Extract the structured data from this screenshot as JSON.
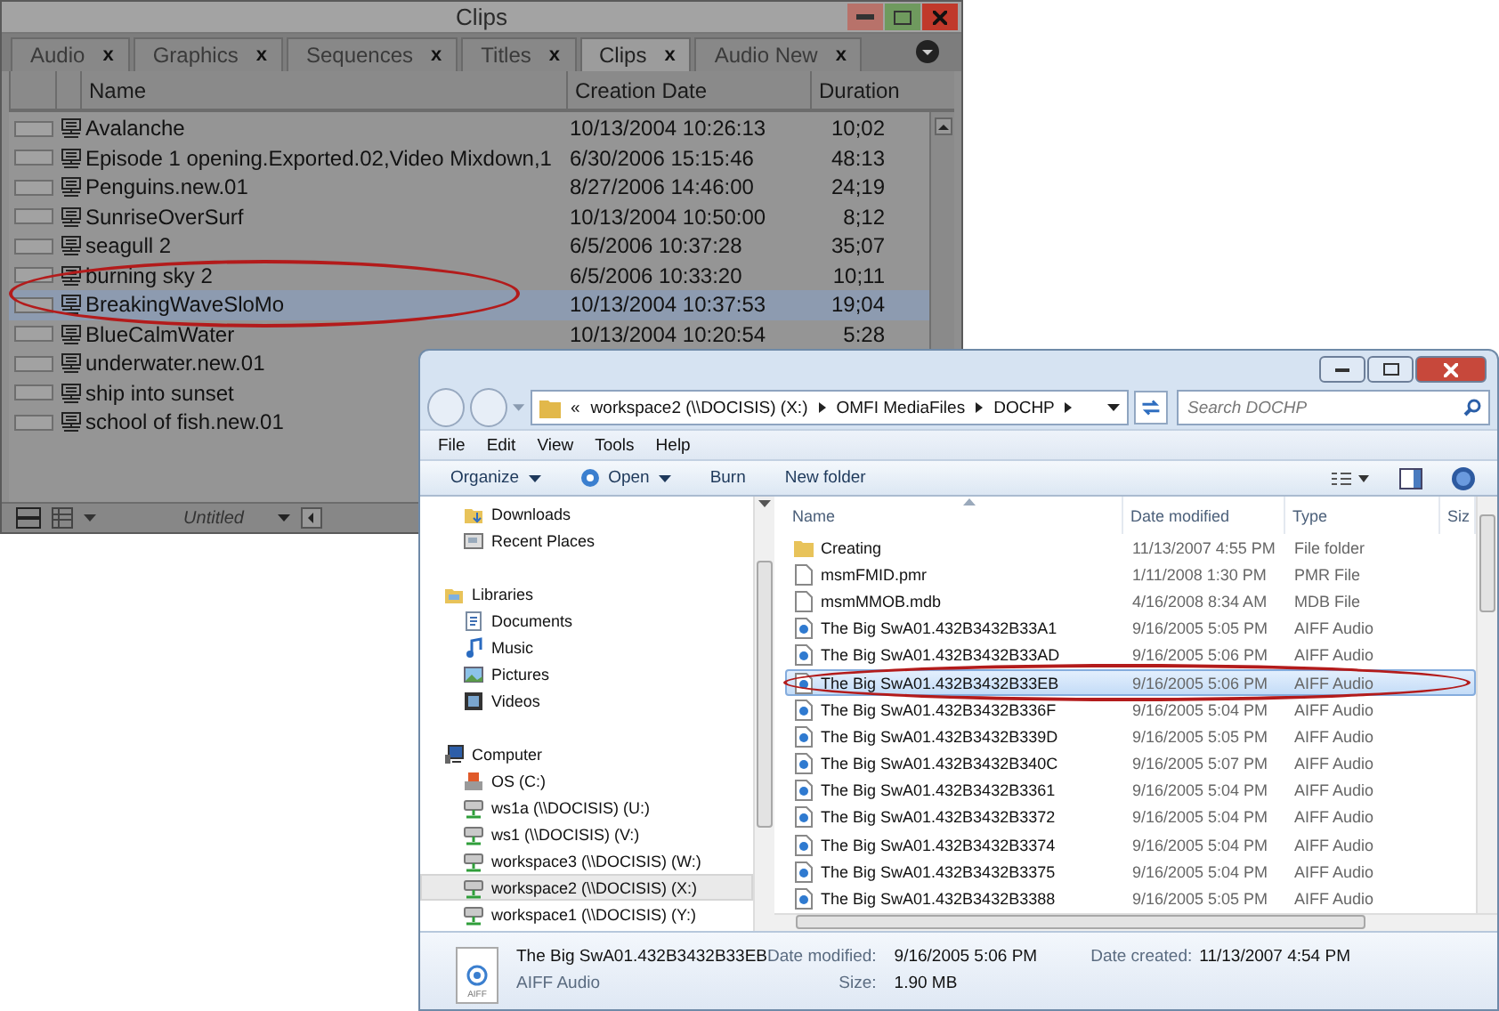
{
  "bin": {
    "title": "Clips",
    "tabs": [
      {
        "label": "Audio",
        "close": "x",
        "selected": false
      },
      {
        "label": "Graphics",
        "close": "x",
        "selected": false
      },
      {
        "label": "Sequences",
        "close": "x",
        "selected": false
      },
      {
        "label": "Titles",
        "close": "x",
        "selected": false
      },
      {
        "label": "Clips",
        "close": "x",
        "selected": true
      },
      {
        "label": "Audio New",
        "close": "x",
        "selected": false
      }
    ],
    "columns": [
      "Name",
      "Creation Date",
      "Duration"
    ],
    "rows": [
      {
        "name": "Avalanche",
        "date": "10/13/2004 10:26:13",
        "duration": "10;02",
        "selected": false
      },
      {
        "name": "Episode 1 opening.Exported.02,Video Mixdown,1",
        "date": "6/30/2006 15:15:46",
        "duration": "48:13",
        "selected": false
      },
      {
        "name": "Penguins.new.01",
        "date": "8/27/2006 14:46:00",
        "duration": "24;19",
        "selected": false
      },
      {
        "name": "SunriseOverSurf",
        "date": "10/13/2004 10:50:00",
        "duration": "8;12",
        "selected": false
      },
      {
        "name": "seagull 2",
        "date": "6/5/2006 10:37:28",
        "duration": "35;07",
        "selected": false
      },
      {
        "name": "burning sky 2",
        "date": "6/5/2006 10:33:20",
        "duration": "10;11",
        "selected": false
      },
      {
        "name": "BreakingWaveSloMo",
        "date": "10/13/2004 10:37:53",
        "duration": "19;04",
        "selected": true
      },
      {
        "name": "BlueCalmWater",
        "date": "10/13/2004 10:20:54",
        "duration": "5:28",
        "selected": false
      },
      {
        "name": "underwater.new.01",
        "selected": false
      },
      {
        "name": "ship into sunset",
        "selected": false
      },
      {
        "name": "school of fish.new.01",
        "selected": false
      }
    ],
    "bin_name": "Untitled"
  },
  "explorer": {
    "breadcrumb_overflow": "«",
    "breadcrumbs": [
      "workspace2 (\\\\DOCISIS) (X:)",
      "OMFI MediaFiles",
      "DOCHP"
    ],
    "search": {
      "placeholder": "Search DOCHP"
    },
    "menu": [
      "File",
      "Edit",
      "View",
      "Tools",
      "Help"
    ],
    "toolbar": [
      {
        "label": "Organize",
        "kind": "menu"
      },
      {
        "label": "Open",
        "kind": "open"
      },
      {
        "label": "Burn",
        "kind": "plain"
      },
      {
        "label": "New folder",
        "kind": "plain"
      }
    ],
    "nav_sections": [
      {
        "children": [
          {
            "label": "Downloads",
            "kind": "downloads",
            "selected": false
          },
          {
            "label": "Recent Places",
            "kind": "recent",
            "selected": false
          }
        ]
      },
      {
        "label": "Libraries",
        "kind": "library",
        "children": [
          {
            "label": "Documents",
            "kind": "document",
            "selected": false
          },
          {
            "label": "Music",
            "kind": "music",
            "selected": false
          },
          {
            "label": "Pictures",
            "kind": "picture",
            "selected": false
          },
          {
            "label": "Videos",
            "kind": "video",
            "selected": false
          }
        ]
      },
      {
        "label": "Computer",
        "kind": "computer",
        "children": [
          {
            "label": "OS (C:)",
            "kind": "drive",
            "selected": false
          },
          {
            "label": "ws1a (\\\\DOCISIS) (U:)",
            "kind": "network",
            "selected": false
          },
          {
            "label": "ws1 (\\\\DOCISIS) (V:)",
            "kind": "network",
            "selected": false
          },
          {
            "label": "workspace3 (\\\\DOCISIS) (W:)",
            "kind": "network",
            "selected": false
          },
          {
            "label": "workspace2 (\\\\DOCISIS) (X:)",
            "kind": "network",
            "selected": true
          },
          {
            "label": "workspace1 (\\\\DOCISIS) (Y:)",
            "kind": "network",
            "selected": false
          }
        ]
      }
    ],
    "columns": [
      "Name",
      "Date modified",
      "Type",
      "Siz"
    ],
    "files": [
      {
        "name": "Creating",
        "date": "11/13/2007 4:55 PM",
        "type": "File folder",
        "kind": "folder",
        "selected": false
      },
      {
        "name": "msmFMID.pmr",
        "date": "1/11/2008 1:30 PM",
        "type": "PMR File",
        "kind": "file",
        "selected": false
      },
      {
        "name": "msmMMOB.mdb",
        "date": "4/16/2008 8:34 AM",
        "type": "MDB File",
        "kind": "file",
        "selected": false
      },
      {
        "name": "The Big SwA01.432B3432B33A1",
        "date": "9/16/2005 5:05 PM",
        "type": "AIFF Audio",
        "kind": "audio",
        "selected": false
      },
      {
        "name": "The Big SwA01.432B3432B33AD",
        "date": "9/16/2005 5:06 PM",
        "type": "AIFF Audio",
        "kind": "audio",
        "selected": false
      },
      {
        "name": "The Big SwA01.432B3432B33EB",
        "date": "9/16/2005 5:06 PM",
        "type": "AIFF Audio",
        "kind": "audio",
        "selected": true
      },
      {
        "name": "The Big SwA01.432B3432B336F",
        "date": "9/16/2005 5:04 PM",
        "type": "AIFF Audio",
        "kind": "audio",
        "selected": false
      },
      {
        "name": "The Big SwA01.432B3432B339D",
        "date": "9/16/2005 5:05 PM",
        "type": "AIFF Audio",
        "kind": "audio",
        "selected": false
      },
      {
        "name": "The Big SwA01.432B3432B340C",
        "date": "9/16/2005 5:07 PM",
        "type": "AIFF Audio",
        "kind": "audio",
        "selected": false
      },
      {
        "name": "The Big SwA01.432B3432B3361",
        "date": "9/16/2005 5:04 PM",
        "type": "AIFF Audio",
        "kind": "audio",
        "selected": false
      },
      {
        "name": "The Big SwA01.432B3432B3372",
        "date": "9/16/2005 5:04 PM",
        "type": "AIFF Audio",
        "kind": "audio",
        "selected": false
      },
      {
        "name": "The Big SwA01.432B3432B3374",
        "date": "9/16/2005 5:04 PM",
        "type": "AIFF Audio",
        "kind": "audio",
        "selected": false
      },
      {
        "name": "The Big SwA01.432B3432B3375",
        "date": "9/16/2005 5:04 PM",
        "type": "AIFF Audio",
        "kind": "audio",
        "selected": false
      },
      {
        "name": "The Big SwA01.432B3432B3388",
        "date": "9/16/2005 5:05 PM",
        "type": "AIFF Audio",
        "kind": "audio",
        "selected": false
      }
    ],
    "details": {
      "icon_label": "AIFF",
      "name": "The Big SwA01.432B3432B33EB",
      "type": "AIFF Audio",
      "fields": [
        {
          "label": "Date modified:",
          "value": "9/16/2005 5:06 PM"
        },
        {
          "label": "Size:",
          "value": "1.90 MB"
        },
        {
          "label": "Date created:",
          "value": "11/13/2007 4:54 PM"
        }
      ]
    }
  }
}
